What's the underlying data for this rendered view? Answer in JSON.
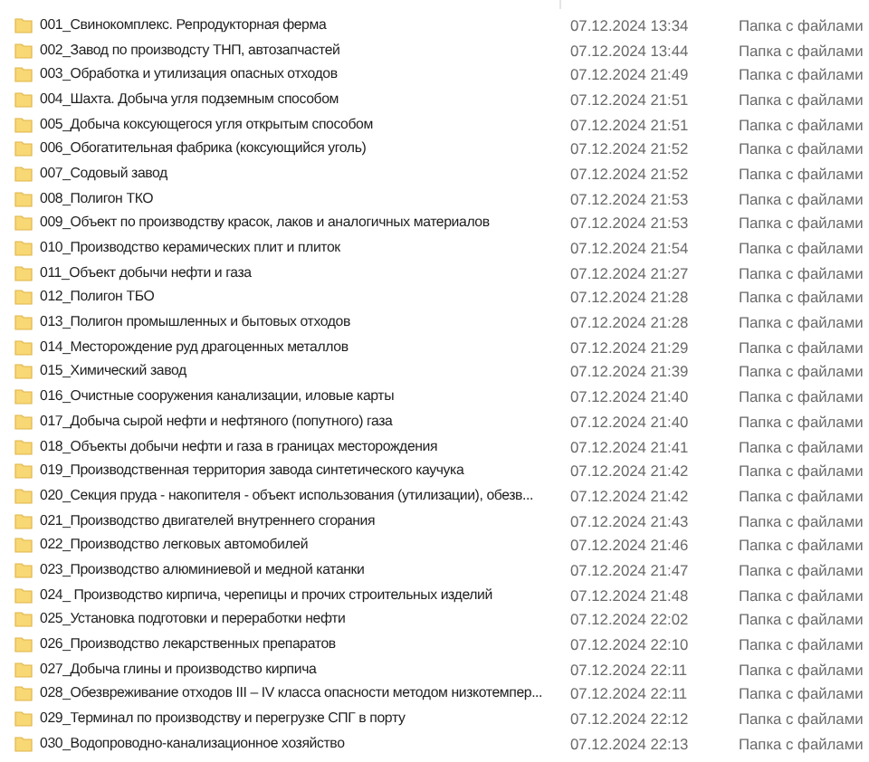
{
  "rows": [
    {
      "name": "001_Свинокомплекс. Репродукторная ферма",
      "date": "07.12.2024 13:34",
      "type": "Папка с файлами"
    },
    {
      "name": "002_Завод по производсту ТНП, автозапчастей",
      "date": "07.12.2024 13:44",
      "type": "Папка с файлами"
    },
    {
      "name": "003_Обработка и утилизация опасных отходов",
      "date": "07.12.2024 21:49",
      "type": "Папка с файлами"
    },
    {
      "name": "004_Шахта. Добыча угля подземным способом",
      "date": "07.12.2024 21:51",
      "type": "Папка с файлами"
    },
    {
      "name": "005_Добыча коксующегося угля открытым способом",
      "date": "07.12.2024 21:51",
      "type": "Папка с файлами"
    },
    {
      "name": "006_Обогатительная фабрика (коксующийся уголь)",
      "date": "07.12.2024 21:52",
      "type": "Папка с файлами"
    },
    {
      "name": "007_Содовый завод",
      "date": "07.12.2024 21:52",
      "type": "Папка с файлами"
    },
    {
      "name": "008_Полигон ТКО",
      "date": "07.12.2024 21:53",
      "type": "Папка с файлами"
    },
    {
      "name": "009_Объект по производству красок, лаков и аналогичных материалов",
      "date": "07.12.2024 21:53",
      "type": "Папка с файлами"
    },
    {
      "name": "010_Производство керамических плит и плиток",
      "date": "07.12.2024 21:54",
      "type": "Папка с файлами"
    },
    {
      "name": "011_Объект добычи нефти и газа",
      "date": "07.12.2024 21:27",
      "type": "Папка с файлами"
    },
    {
      "name": "012_Полигон ТБО",
      "date": "07.12.2024 21:28",
      "type": "Папка с файлами"
    },
    {
      "name": "013_Полигон промышленных и бытовых отходов",
      "date": "07.12.2024 21:28",
      "type": "Папка с файлами"
    },
    {
      "name": "014_Месторождение руд драгоценных металлов",
      "date": "07.12.2024 21:29",
      "type": "Папка с файлами"
    },
    {
      "name": "015_Химический завод",
      "date": "07.12.2024 21:39",
      "type": "Папка с файлами"
    },
    {
      "name": "016_Очистные сооружения канализации, иловые карты",
      "date": "07.12.2024 21:40",
      "type": "Папка с файлами"
    },
    {
      "name": "017_Добыча сырой нефти и нефтяного (попутного) газа",
      "date": "07.12.2024 21:40",
      "type": "Папка с файлами"
    },
    {
      "name": "018_Объекты добычи нефти и газа в границах месторождения",
      "date": "07.12.2024 21:41",
      "type": "Папка с файлами"
    },
    {
      "name": "019_Производственная территория завода синтетического каучука",
      "date": "07.12.2024 21:42",
      "type": "Папка с файлами"
    },
    {
      "name": "020_Секция пруда - накопителя - объект  использования (утилизации), обезв...",
      "date": "07.12.2024 21:42",
      "type": "Папка с файлами"
    },
    {
      "name": "021_Производство двигателей внутреннего сгорания",
      "date": "07.12.2024 21:43",
      "type": "Папка с файлами"
    },
    {
      "name": "022_Производство легковых автомобилей",
      "date": "07.12.2024 21:46",
      "type": "Папка с файлами"
    },
    {
      "name": "023_Производство алюминиевой и медной катанки",
      "date": "07.12.2024 21:47",
      "type": "Папка с файлами"
    },
    {
      "name": "024_ Производство кирпича, черепицы и прочих строительных изделий",
      "date": "07.12.2024 21:48",
      "type": "Папка с файлами"
    },
    {
      "name": "025_Установка подготовки и переработки нефти",
      "date": "07.12.2024 22:02",
      "type": "Папка с файлами"
    },
    {
      "name": "026_Производство лекарственных препаратов",
      "date": "07.12.2024 22:10",
      "type": "Папка с файлами"
    },
    {
      "name": "027_Добыча глины и производство кирпича",
      "date": "07.12.2024 22:11",
      "type": "Папка с файлами"
    },
    {
      "name": "028_Обезвреживание отходов III – IV класса опасности методом низкотемпер...",
      "date": "07.12.2024 22:11",
      "type": "Папка с файлами"
    },
    {
      "name": "029_Терминал по производству и перегрузке СПГ в порту",
      "date": "07.12.2024 22:12",
      "type": "Папка с файлами"
    },
    {
      "name": "030_Водопроводно-канализационное хозяйство",
      "date": "07.12.2024 22:13",
      "type": "Папка с файлами"
    }
  ]
}
